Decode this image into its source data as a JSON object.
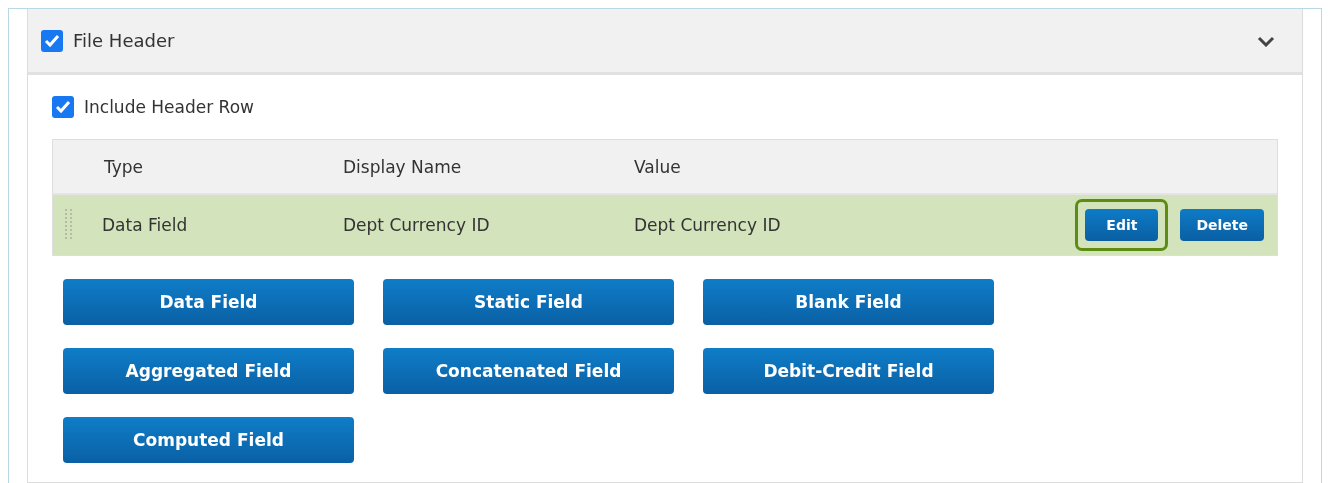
{
  "section": {
    "title": "File Header",
    "checked": true,
    "expanded": true
  },
  "include_header_row": {
    "label": "Include Header Row",
    "checked": true
  },
  "table": {
    "columns": [
      "Type",
      "Display Name",
      "Value"
    ],
    "rows": [
      {
        "cells": [
          "Data Field",
          "Dept Currency ID",
          "Dept Currency ID"
        ],
        "selected": true,
        "actions": [
          {
            "label": "Edit",
            "focused": true
          },
          {
            "label": "Delete",
            "focused": false
          }
        ]
      }
    ]
  },
  "add_buttons": [
    "Data Field",
    "Static Field",
    "Blank Field",
    "Aggregated Field",
    "Concatenated Field",
    "Debit-Credit Field",
    "Computed Field"
  ]
}
